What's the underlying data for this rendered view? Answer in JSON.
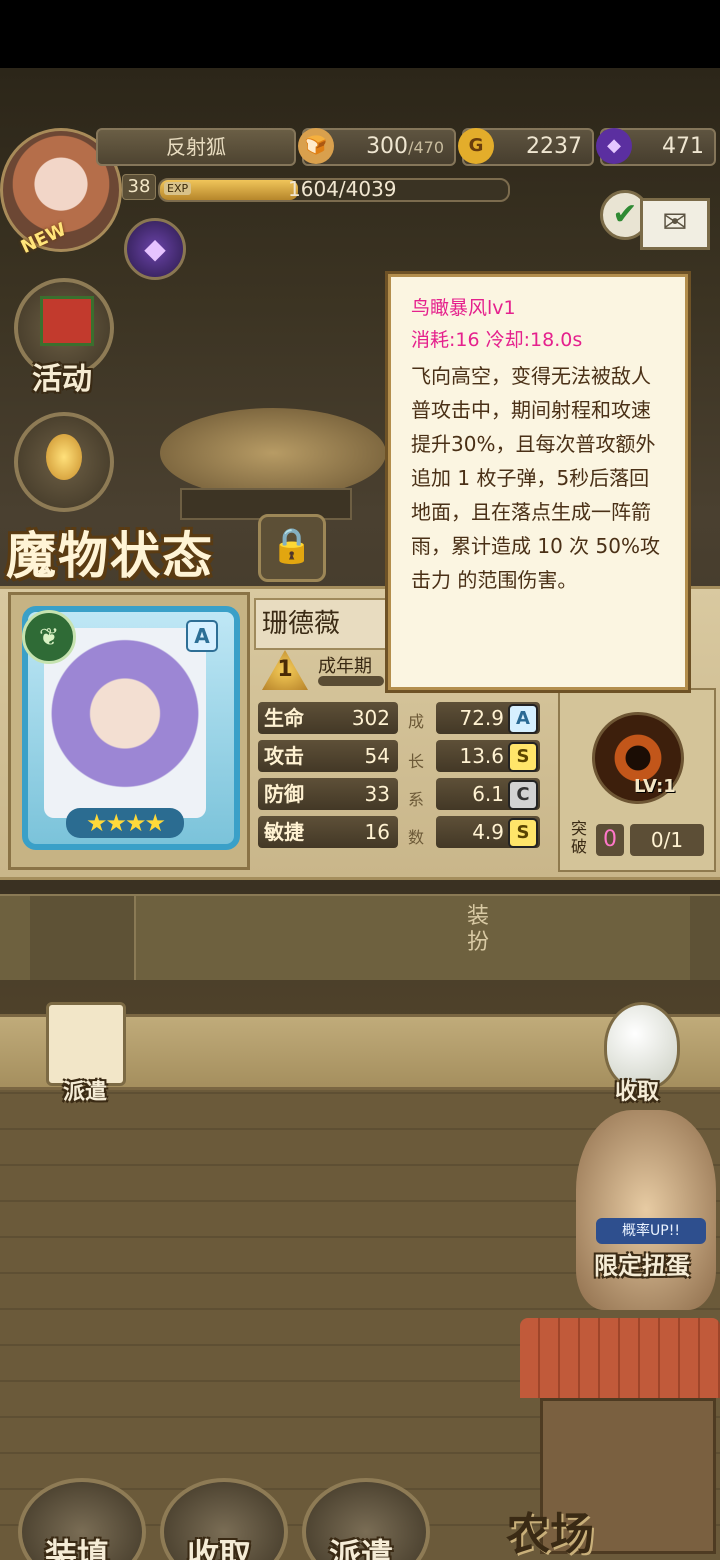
{
  "header": {
    "player_name": "反射狐",
    "new_badge": "NEW",
    "level": "38",
    "exp_tag": "EXP",
    "exp_value": "1604/4039",
    "exp_fraction": 0.397
  },
  "resources": {
    "bread_value": "300",
    "bread_max": "/470",
    "gold_icon": "G",
    "gold_value": "2237",
    "gem_value": "471"
  },
  "side": {
    "events_label": "活动"
  },
  "title": "魔物状态",
  "monster": {
    "name": "珊德薇",
    "rank": "A",
    "stage_num": "1",
    "stage_label": "成年期",
    "star_count": 4,
    "stats": [
      {
        "label": "生命",
        "value": "302",
        "growth": "72.9",
        "grade": "A"
      },
      {
        "label": "攻击",
        "value": "54",
        "growth": "13.6",
        "grade": "S"
      },
      {
        "label": "防御",
        "value": "33",
        "growth": "6.1",
        "grade": "C"
      },
      {
        "label": "敏捷",
        "value": "16",
        "growth": "4.9",
        "grade": "S"
      }
    ],
    "growth_vertical": [
      "成",
      "长",
      "系",
      "数"
    ]
  },
  "skill": {
    "level": "LV:1",
    "breakthrough_label": "突破",
    "breakthrough_value": "0",
    "breakthrough_count": "0/1"
  },
  "tooltip": {
    "title": "鸟瞰暴风lv1",
    "meta": "消耗:16  冷却:18.0s",
    "body": "飞向高空，变得无法被敌人普攻击中，期间射程和攻速提升30%，且每次普攻额外追加 1 枚子弹，5秒后落回地面，且在落点生成一阵箭雨，累计造成 10 次 50%攻击力 的范围伤害。"
  },
  "equip": {
    "label": "装扮"
  },
  "actions": {
    "dispatch": "派遣",
    "collect": "收取",
    "gacha_tag": "概率UP!!",
    "gacha_label": "限定扭蛋"
  },
  "nav": {
    "items": [
      {
        "label": "装填"
      },
      {
        "label": "收取"
      },
      {
        "label": "派遣"
      }
    ],
    "farm": "农场"
  }
}
